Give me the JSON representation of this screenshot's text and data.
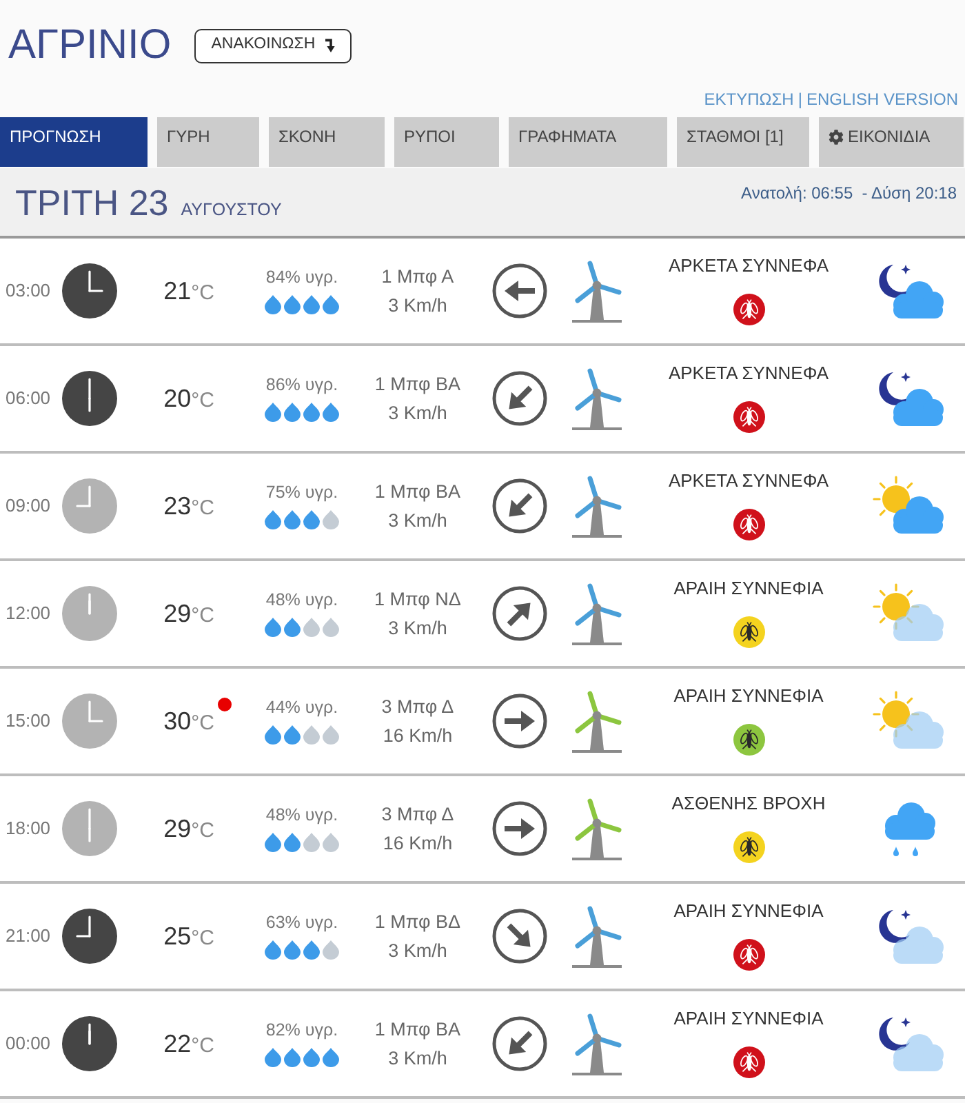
{
  "header": {
    "title": "ΑΓΡΙΝΙΟ",
    "announcement_button": "ΑΝΑΚΟΙΝΩΣΗ"
  },
  "links": {
    "print": "ΕΚΤΥΠΩΣΗ",
    "separator": "|",
    "language": "ENGLISH VERSION"
  },
  "tabs": [
    {
      "label": "ΠΡΟΓΝΩΣΗ",
      "selected": true,
      "kind": "text"
    },
    {
      "label": "ΓΥΡΗ",
      "selected": false,
      "kind": "text"
    },
    {
      "label": "ΣΚΟΝΗ",
      "selected": false,
      "kind": "text"
    },
    {
      "label": "ΡΥΠΟΙ",
      "selected": false,
      "kind": "text"
    },
    {
      "label": "ΓΡΑΦΗΜΑΤΑ",
      "selected": false,
      "kind": "text"
    },
    {
      "label": "ΣΤΑΘΜΟΙ [1]",
      "selected": false,
      "kind": "text"
    },
    {
      "label": "ΕΙΚΟΝΙΔΙΑ",
      "selected": false,
      "kind": "settings"
    }
  ],
  "day": {
    "weekday_date": "ΤΡΙΤΗ 23",
    "month": "ΑΥΓΟΥΣΤΟΥ",
    "sun": "Ανατολή: 06:55  - Δύση 20:18"
  },
  "forecast": [
    {
      "time": "03:00",
      "night": true,
      "temperature": "21",
      "unit": "°C",
      "peak": false,
      "humidity": {
        "text": "84% υγρ.",
        "stars": 4
      },
      "wind": {
        "force": "1 Μπφ Α",
        "speed": "3 Km/h",
        "arrow": {
          "kind": "west"
        }
      },
      "turbine": {
        "color": "#4a9fd8"
      },
      "condition": "ΑΡΚΕΤΑ ΣΥΝΝΕΦΑ",
      "mosquito": {
        "kind": "high",
        "color": "#d0111b"
      },
      "sky": {
        "kind": "moon",
        "faded": false
      }
    },
    {
      "time": "06:00",
      "night": true,
      "temperature": "20",
      "unit": "°C",
      "peak": false,
      "humidity": {
        "text": "86% υγρ.",
        "stars": 4
      },
      "wind": {
        "force": "1 Μπφ ΒΑ",
        "speed": "3 Km/h",
        "arrow": {
          "kind": "southwest"
        }
      },
      "turbine": {
        "color": "#4a9fd8"
      },
      "condition": "ΑΡΚΕΤΑ ΣΥΝΝΕΦΑ",
      "mosquito": {
        "kind": "high",
        "color": "#d0111b"
      },
      "sky": {
        "kind": "moon",
        "faded": false
      }
    },
    {
      "time": "09:00",
      "night": false,
      "temperature": "23",
      "unit": "°C",
      "peak": false,
      "humidity": {
        "text": "75% υγρ.",
        "stars": 3
      },
      "wind": {
        "force": "1 Μπφ ΒΑ",
        "speed": "3 Km/h",
        "arrow": {
          "kind": "southwest"
        }
      },
      "turbine": {
        "color": "#4a9fd8"
      },
      "condition": "ΑΡΚΕΤΑ ΣΥΝΝΕΦΑ",
      "mosquito": {
        "kind": "high",
        "color": "#d0111b"
      },
      "sky": {
        "kind": "sun",
        "faded": false
      }
    },
    {
      "time": "12:00",
      "night": false,
      "temperature": "29",
      "unit": "°C",
      "peak": false,
      "humidity": {
        "text": "48% υγρ.",
        "stars": 2
      },
      "wind": {
        "force": "1 Μπφ ΝΔ",
        "speed": "3 Km/h",
        "arrow": {
          "kind": "northeast"
        }
      },
      "turbine": {
        "color": "#4a9fd8"
      },
      "condition": "ΑΡΑΙΗ ΣΥΝΝΕΦΙΑ",
      "mosquito": {
        "kind": "medium",
        "color": "#f4d31f"
      },
      "sky": {
        "kind": "sun",
        "faded": true
      }
    },
    {
      "time": "15:00",
      "night": false,
      "temperature": "30",
      "unit": "°C",
      "peak": true,
      "humidity": {
        "text": "44% υγρ.",
        "stars": 2
      },
      "wind": {
        "force": "3 Μπφ Δ",
        "speed": "16 Km/h",
        "arrow": {
          "kind": "east"
        }
      },
      "turbine": {
        "color": "#8cc63f"
      },
      "condition": "ΑΡΑΙΗ ΣΥΝΝΕΦΙΑ",
      "mosquito": {
        "kind": "low",
        "color": "#8dc63f"
      },
      "sky": {
        "kind": "sun",
        "faded": true
      }
    },
    {
      "time": "18:00",
      "night": false,
      "temperature": "29",
      "unit": "°C",
      "peak": false,
      "humidity": {
        "text": "48% υγρ.",
        "stars": 2
      },
      "wind": {
        "force": "3 Μπφ Δ",
        "speed": "16 Km/h",
        "arrow": {
          "kind": "east"
        }
      },
      "turbine": {
        "color": "#8cc63f"
      },
      "condition": "ΑΣΘΕΝΗΣ ΒΡΟΧΗ",
      "mosquito": {
        "kind": "medium",
        "color": "#f4d31f"
      },
      "sky": {
        "kind": "rain",
        "faded": false
      }
    },
    {
      "time": "21:00",
      "night": true,
      "temperature": "25",
      "unit": "°C",
      "peak": false,
      "humidity": {
        "text": "63% υγρ.",
        "stars": 3
      },
      "wind": {
        "force": "1 Μπφ ΒΔ",
        "speed": "3 Km/h",
        "arrow": {
          "kind": "southeast"
        }
      },
      "turbine": {
        "color": "#4a9fd8"
      },
      "condition": "ΑΡΑΙΗ ΣΥΝΝΕΦΙΑ",
      "mosquito": {
        "kind": "high",
        "color": "#d0111b"
      },
      "sky": {
        "kind": "moon",
        "faded": true
      }
    },
    {
      "time": "00:00",
      "night": true,
      "temperature": "22",
      "unit": "°C",
      "peak": false,
      "humidity": {
        "text": "82% υγρ.",
        "stars": 4
      },
      "wind": {
        "force": "1 Μπφ ΒΑ",
        "speed": "3 Km/h",
        "arrow": {
          "kind": "southwest"
        }
      },
      "turbine": {
        "color": "#4a9fd8"
      },
      "condition": "ΑΡΑΙΗ ΣΥΝΝΕΦΙΑ",
      "mosquito": {
        "kind": "high",
        "color": "#d0111b"
      },
      "sky": {
        "kind": "moon",
        "faded": true
      }
    }
  ]
}
